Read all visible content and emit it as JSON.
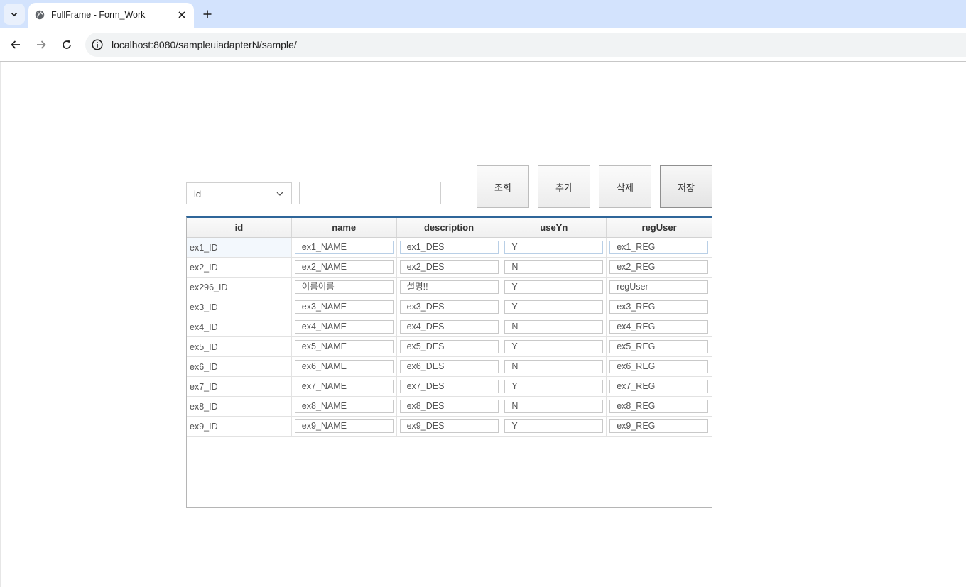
{
  "browser": {
    "tab_title": "FullFrame - Form_Work",
    "url": "localhost:8080/sampleuiadapterN/sample/"
  },
  "search": {
    "select_value": "id",
    "input_value": ""
  },
  "buttons": {
    "query": "조회",
    "add": "추가",
    "delete": "삭제",
    "save": "저장"
  },
  "grid": {
    "headers": [
      "id",
      "name",
      "description",
      "useYn",
      "regUser"
    ],
    "rows": [
      {
        "id": "ex1_ID",
        "name": "ex1_NAME",
        "description": "ex1_DES",
        "useYn": "Y",
        "regUser": "ex1_REG"
      },
      {
        "id": "ex2_ID",
        "name": "ex2_NAME",
        "description": "ex2_DES",
        "useYn": "N",
        "regUser": "ex2_REG"
      },
      {
        "id": "ex296_ID",
        "name": "이름이름",
        "description": "설명!!",
        "useYn": "Y",
        "regUser": "regUser"
      },
      {
        "id": "ex3_ID",
        "name": "ex3_NAME",
        "description": "ex3_DES",
        "useYn": "Y",
        "regUser": "ex3_REG"
      },
      {
        "id": "ex4_ID",
        "name": "ex4_NAME",
        "description": "ex4_DES",
        "useYn": "N",
        "regUser": "ex4_REG"
      },
      {
        "id": "ex5_ID",
        "name": "ex5_NAME",
        "description": "ex5_DES",
        "useYn": "Y",
        "regUser": "ex5_REG"
      },
      {
        "id": "ex6_ID",
        "name": "ex6_NAME",
        "description": "ex6_DES",
        "useYn": "N",
        "regUser": "ex6_REG"
      },
      {
        "id": "ex7_ID",
        "name": "ex7_NAME",
        "description": "ex7_DES",
        "useYn": "Y",
        "regUser": "ex7_REG"
      },
      {
        "id": "ex8_ID",
        "name": "ex8_NAME",
        "description": "ex8_DES",
        "useYn": "N",
        "regUser": "ex8_REG"
      },
      {
        "id": "ex9_ID",
        "name": "ex9_NAME",
        "description": "ex9_DES",
        "useYn": "Y",
        "regUser": "ex9_REG"
      }
    ],
    "selected_row": 0
  },
  "colors": {
    "tabstrip": "#d3e3fd",
    "grid_header_border": "#2f6699"
  }
}
